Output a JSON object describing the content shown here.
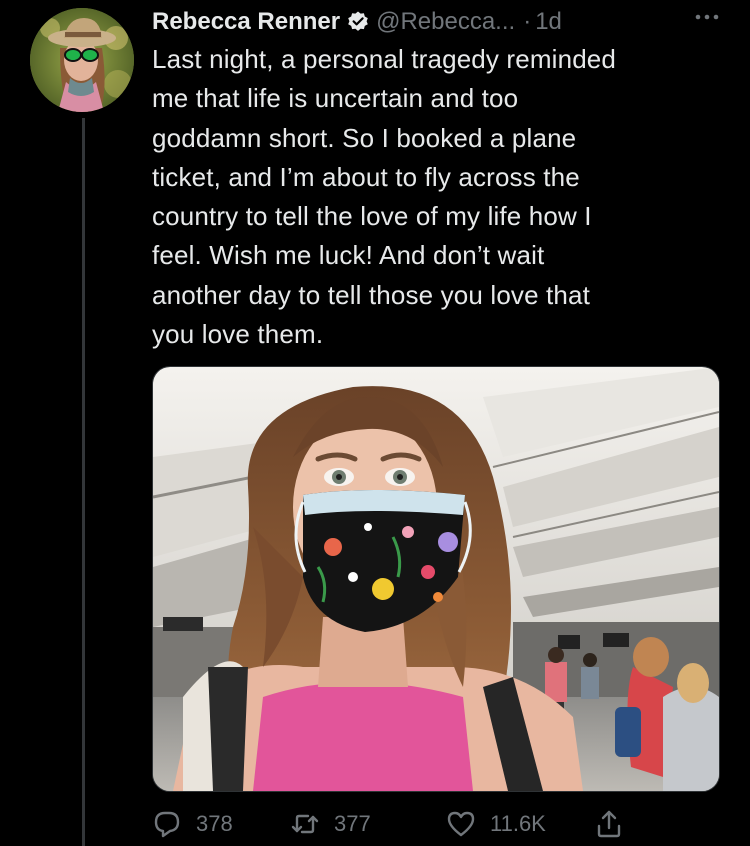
{
  "tweet": {
    "display_name": "Rebecca Renner",
    "handle": "@Rebecca...",
    "separator": "·",
    "time": "1d",
    "verified": true,
    "text_lines": [
      "Last night, a personal tragedy reminded",
      "me that life is uncertain and too",
      "goddamn short. So I booked a plane",
      "ticket, and I’m about to fly across the",
      "country to tell the love of my life how I",
      "feel. Wish me luck! And don’t wait",
      "another day to tell those you love that",
      "you love them."
    ],
    "media": {
      "type": "photo",
      "subject": "selfie"
    }
  },
  "actions": {
    "reply": {
      "icon": "reply-icon",
      "count": "378"
    },
    "retweet": {
      "icon": "retweet-icon",
      "count": "377"
    },
    "like": {
      "icon": "heart-icon",
      "count": "11.6K"
    },
    "share": {
      "icon": "share-icon"
    }
  },
  "colors": {
    "background": "#000000",
    "text": "#e7e9ea",
    "muted": "#71767b",
    "verified": "#1d9bf0",
    "thread_line": "#333639"
  }
}
